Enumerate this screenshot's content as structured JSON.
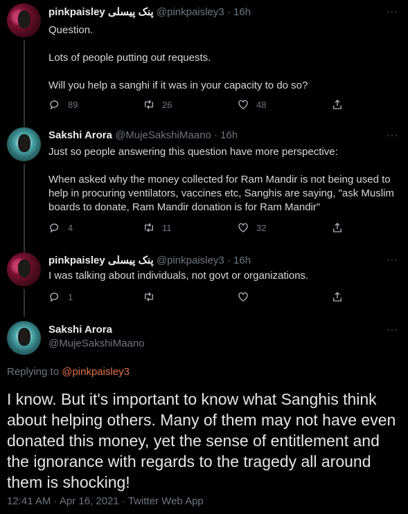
{
  "tweets": [
    {
      "name": "pinkpaisley",
      "name_extra": "پنک پیسلی",
      "handle": "@pinkpaisley3",
      "time": "16h",
      "lines": [
        "Question.",
        "",
        "Lots of people putting out requests.",
        "",
        "Will you help a sanghi if it was in your capacity to do so?"
      ],
      "replies": "89",
      "retweets": "26",
      "likes": "48"
    },
    {
      "name": "Sakshi Arora",
      "handle": "@MujeSakshiMaano",
      "time": "16h",
      "lines": [
        "Just so people answering this question have more perspective:",
        "",
        "When asked why the money collected for Ram Mandir is not being used to",
        "help in procuring ventilators, vaccines etc, Sanghis are saying, \"ask Muslim",
        "boards to donate, Ram Mandir donation is for Ram Mandir\""
      ],
      "replies": "4",
      "retweets": "11",
      "likes": "32"
    },
    {
      "name": "pinkpaisley",
      "name_extra": "پنک پیسلی",
      "handle": "@pinkpaisley3",
      "time": "16h",
      "lines": [
        "I was talking about individuals, not govt or organizations."
      ],
      "replies": "1",
      "retweets": "",
      "likes": ""
    }
  ],
  "main": {
    "name": "Sakshi Arora",
    "handle": "@MujeSakshiMaano",
    "replying_prefix": "Replying to",
    "replying_handle": "@pinkpaisley3",
    "text_lines": [
      "I know. But it's important to know what Sanghis think",
      "about helping others. Many of them may not have even",
      "donated this money, yet the sense of entitlement and",
      "the ignorance with regards to the tragedy all around",
      "them is shocking!"
    ],
    "timestamp": "12:41 AM · Apr 16, 2021 · Twitter Web App"
  },
  "sep": "·",
  "more_glyph": "···",
  "colors": {
    "background": "#000000",
    "mention": "#e4714b",
    "muted": "#6e767d"
  },
  "icons": {
    "reply": "reply-icon",
    "retweet": "retweet-icon",
    "like": "like-icon",
    "share": "share-icon",
    "more": "more-icon"
  }
}
